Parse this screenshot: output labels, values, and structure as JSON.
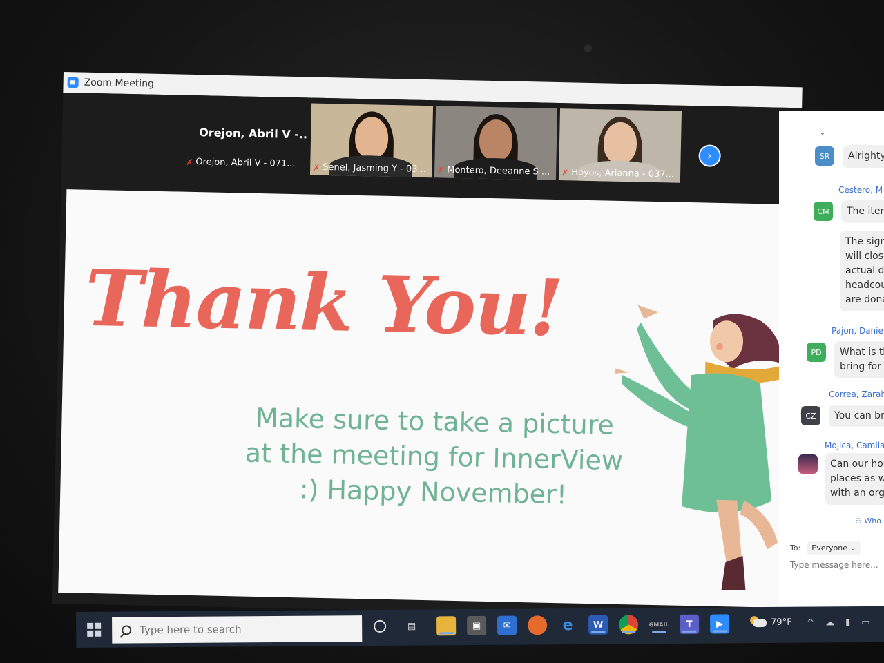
{
  "window": {
    "title": "Zoom Meeting"
  },
  "gallery": {
    "active_speaker_name": "Orejon, Abril V -...",
    "participants": [
      {
        "label": "Orejon, Abril V - 071..."
      },
      {
        "label": "Senel, Jasming Y - 03..."
      },
      {
        "label": "Montero, Deeanne S ..."
      },
      {
        "label": "Hoyos, Arianna - 037..."
      }
    ]
  },
  "slide": {
    "heading": "Thank You!",
    "body": "Make sure to take a picture at the meeting for InnerView :) Happy November!"
  },
  "chat": {
    "messages": [
      {
        "initials": "SR",
        "avatar_color": "#4a8dc9",
        "sender": "",
        "text": "Alrighty"
      },
      {
        "initials": "CM",
        "avatar_color": "#3fae5a",
        "sender": "Cestero, M",
        "text": "The item",
        "extra_lines": [
          "The sign",
          "will close",
          "actual dri",
          "headcoun",
          "are donat"
        ]
      },
      {
        "initials": "PD",
        "avatar_color": "#3fae5a",
        "sender": "Pajon, Daniel",
        "text": "What is th",
        "extra_lines": [
          "bring for t"
        ]
      },
      {
        "initials": "CZ",
        "avatar_color": "#3d4148",
        "sender": "Correa, Zarah",
        "text": "You can bri"
      },
      {
        "initials": "",
        "avatar_color": "#3a2b4e",
        "sender": "Mojica, Camila",
        "text": "Can our hou",
        "extra_lines": [
          "places as we",
          "with an orga"
        ]
      }
    ],
    "who_label": "Who",
    "to_label": "To:",
    "recipient": "Everyone",
    "input_placeholder": "Type message here..."
  },
  "taskbar": {
    "search_placeholder": "Type here to search",
    "weather": "79°F",
    "apps": [
      "cortana-icon",
      "task-view-icon",
      "file-explorer-icon",
      "store-icon",
      "mail-icon",
      "firefox-icon",
      "edge-icon",
      "word-icon",
      "chrome-icon",
      "gmail-icon",
      "teams-icon",
      "zoom-icon"
    ]
  },
  "colors": {
    "thanks_red": "#e8675a",
    "subtext_green": "#6fb394",
    "zoom_blue": "#2d8cff"
  }
}
